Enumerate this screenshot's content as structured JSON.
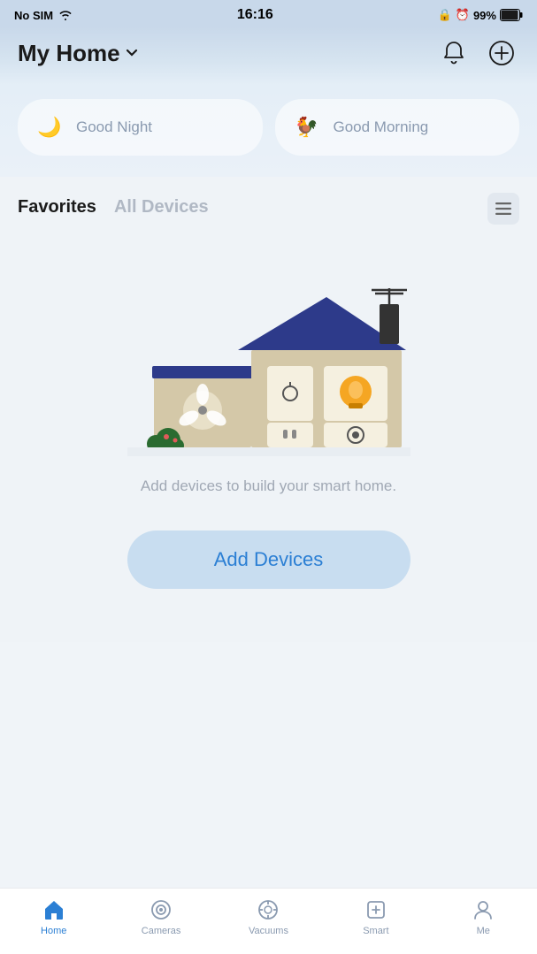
{
  "statusBar": {
    "carrier": "No SIM",
    "time": "16:16",
    "battery": "99%"
  },
  "header": {
    "title": "My Home",
    "dropdownLabel": "My Home dropdown",
    "bellLabel": "Notifications",
    "addLabel": "Add"
  },
  "scenes": [
    {
      "id": "good-night",
      "label": "Good Night",
      "icon": "🌙"
    },
    {
      "id": "good-morning",
      "label": "Good Morning",
      "icon": "🐓"
    }
  ],
  "tabs": {
    "favorites": "Favorites",
    "allDevices": "All Devices"
  },
  "main": {
    "emptyText": "Add devices to build your smart home.",
    "addDevicesLabel": "Add Devices"
  },
  "bottomNav": [
    {
      "id": "home",
      "label": "Home",
      "active": true
    },
    {
      "id": "cameras",
      "label": "Cameras",
      "active": false
    },
    {
      "id": "vacuums",
      "label": "Vacuums",
      "active": false
    },
    {
      "id": "smart",
      "label": "Smart",
      "active": false
    },
    {
      "id": "me",
      "label": "Me",
      "active": false
    }
  ]
}
